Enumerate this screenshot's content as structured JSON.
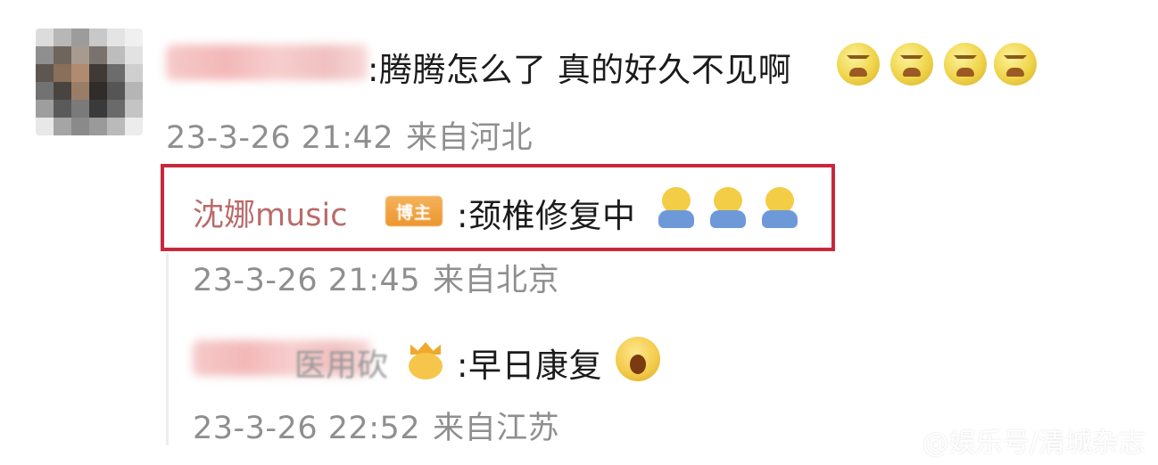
{
  "comment": {
    "text": ":腾腾怎么了 真的好久不见啊",
    "emoji_icon": "angry-face-icon",
    "emoji_count": 4,
    "time": "23-3-26 21:42",
    "location": "来自河北"
  },
  "replies": [
    {
      "user": "沈娜music",
      "badge": "博主",
      "text": ":颈椎修复中",
      "emoji_icon": "doge-icon",
      "emoji_count": 3,
      "time": "23-3-26 21:45",
      "location": "来自北京",
      "highlight_color": "#c8283c"
    },
    {
      "user_partial": "医用砍",
      "text": ":早日康复",
      "emoji_icon": "shocked-face-icon",
      "time": "23-3-26 22:52",
      "location": "来自江苏"
    }
  ],
  "watermark": "@娱乐号/清城杂志"
}
